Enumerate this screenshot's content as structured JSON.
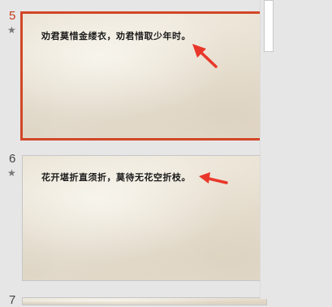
{
  "colors": {
    "panel_bg": "#e6e6e6",
    "selected_border": "#d24726",
    "selected_number": "#c43e1c",
    "arrow": "#e8372a",
    "parchment": "#ede6d9"
  },
  "slides": [
    {
      "number": "5",
      "star": "★",
      "text": "劝君莫惜金缕衣，劝君惜取少年时。",
      "selected": true
    },
    {
      "number": "6",
      "star": "★",
      "text": "花开堪折直须折，莫待无花空折枝。",
      "selected": false
    },
    {
      "number": "7"
    }
  ],
  "icons": {
    "star": "star-icon",
    "arrow": "red-arrow-annotation"
  }
}
